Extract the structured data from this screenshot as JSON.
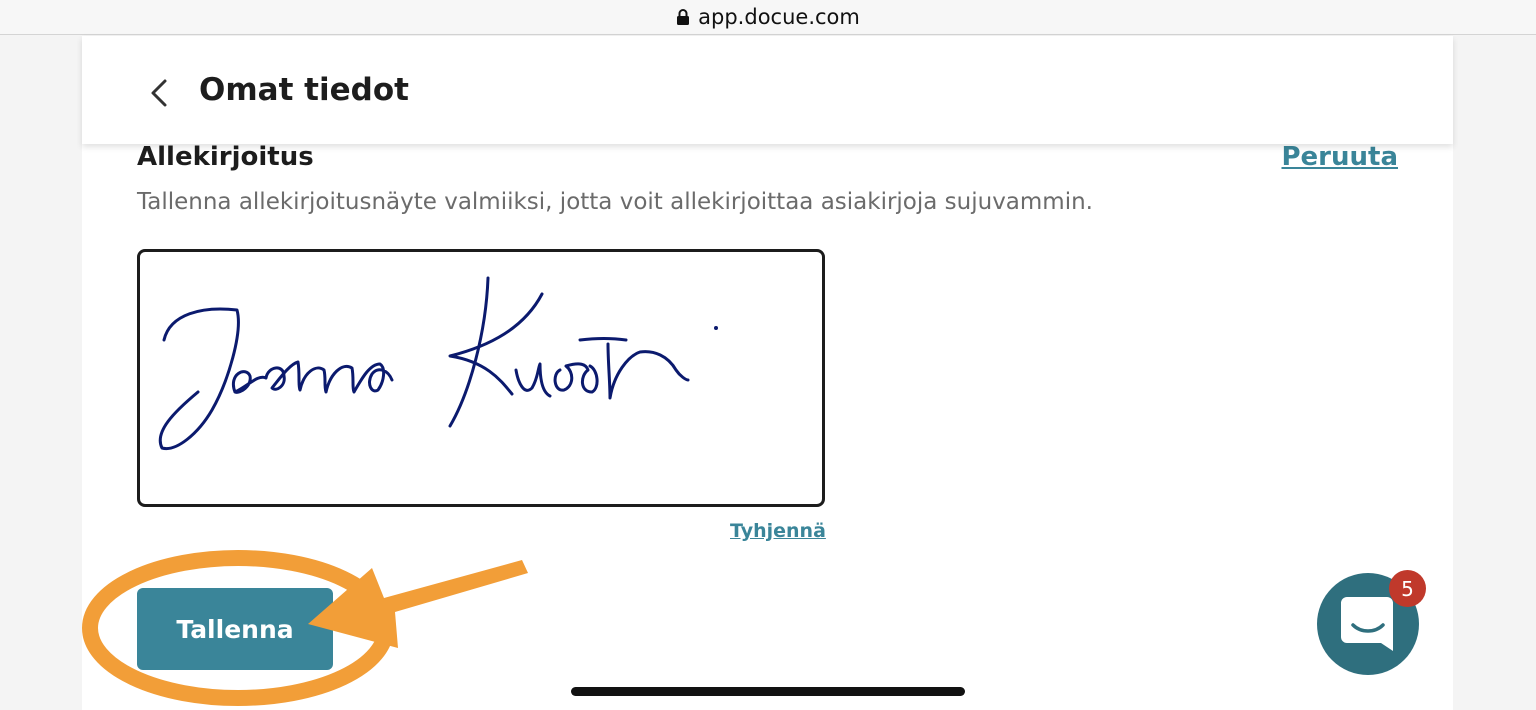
{
  "browser": {
    "url": "app.docue.com"
  },
  "header": {
    "title": "Omat tiedot",
    "back_icon": "chevron-left-icon"
  },
  "signature": {
    "section_title": "Allekirjoitus",
    "cancel_label": "Peruuta",
    "description": "Tallenna allekirjoitusnäyte valmiiksi, jotta voit allekirjoittaa asiakirjoja sujuvammin.",
    "clear_label": "Tyhjennä",
    "ink_color": "#0b1a6e"
  },
  "actions": {
    "save_label": "Tallenna"
  },
  "chat": {
    "badge_count": "5",
    "icon": "chat-bubble-icon"
  },
  "colors": {
    "accent": "#3a8599",
    "annotation": "#f29e38",
    "badge": "#c0392b"
  }
}
